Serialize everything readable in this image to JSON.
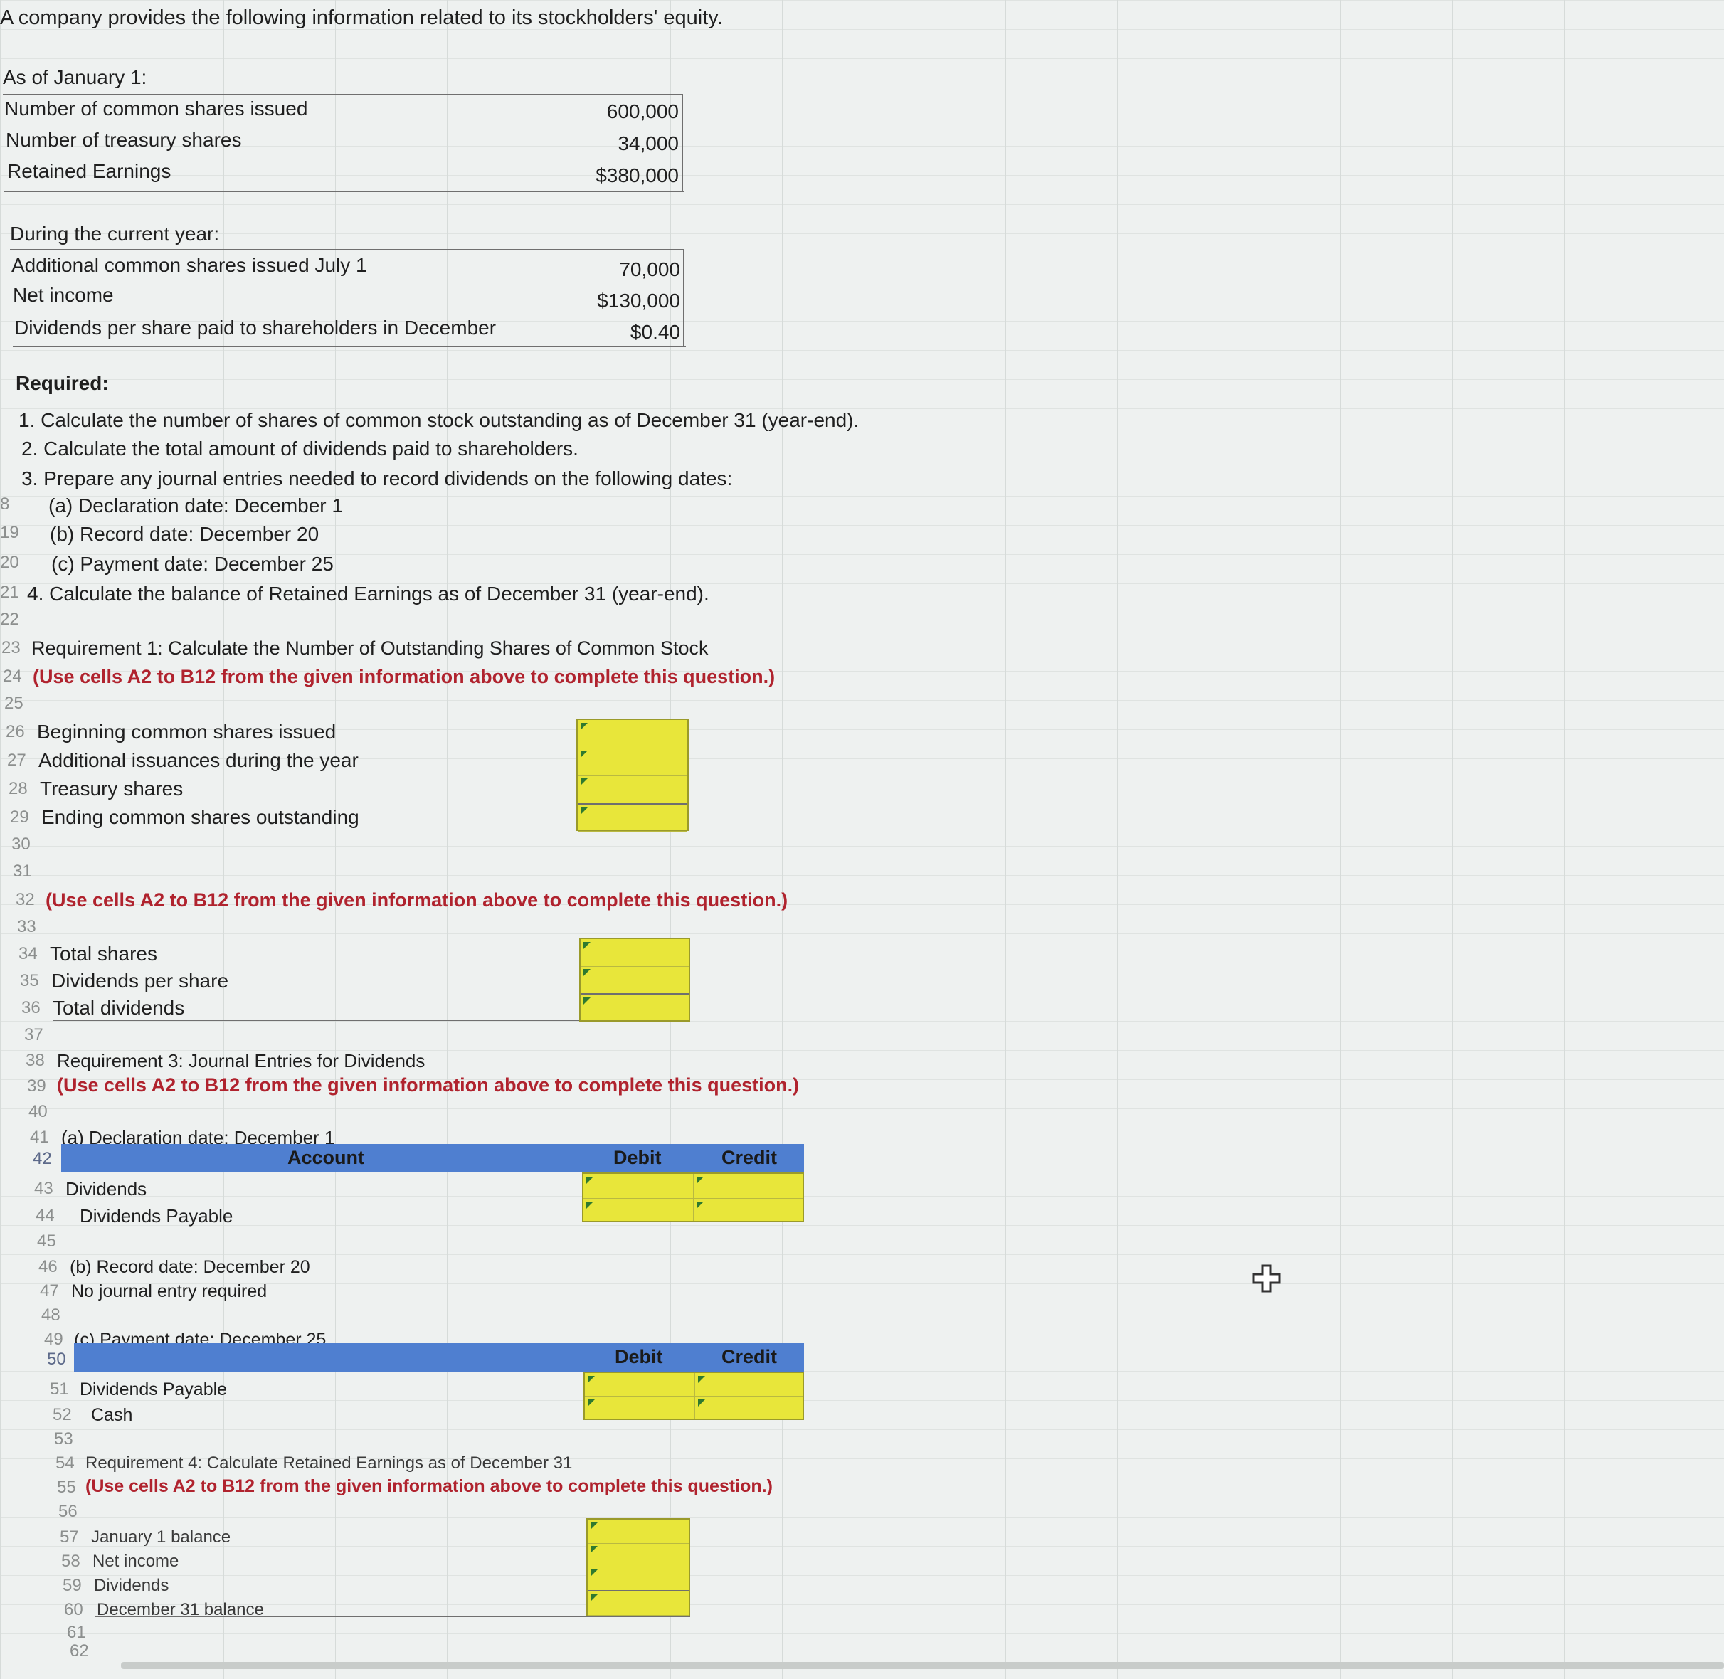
{
  "intro": "A company provides the following information related to its stockholders' equity.",
  "jan1": {
    "heading": "As of January 1:",
    "rows": [
      {
        "label": "Number of common shares issued",
        "value": "600,000"
      },
      {
        "label": "Number of treasury shares",
        "value": "34,000"
      },
      {
        "label": "Retained Earnings",
        "value": "$380,000"
      }
    ]
  },
  "year": {
    "heading": "During the current year:",
    "rows": [
      {
        "label": "Additional common shares issued July 1",
        "value": "70,000"
      },
      {
        "label": "Net income",
        "value": "$130,000"
      },
      {
        "label": "Dividends per share paid to shareholders in December",
        "value": "$0.40"
      }
    ]
  },
  "required": {
    "heading": "Required:",
    "items": [
      "1. Calculate the number of shares of common stock outstanding as of December 31 (year-end).",
      "2. Calculate the total amount of dividends paid to shareholders.",
      "3. Prepare any journal entries needed to record dividends on the following dates:",
      "(a) Declaration date: December 1",
      "(b) Record date: December 20",
      "(c) Payment date: December 25",
      "4. Calculate the balance of Retained Earnings as of December 31 (year-end)."
    ]
  },
  "row_numbers": [
    "8",
    "19",
    "20",
    "21",
    "22",
    "23",
    "24",
    "25",
    "26",
    "27",
    "28",
    "29",
    "30",
    "31",
    "32",
    "33",
    "34",
    "35",
    "36",
    "37",
    "38",
    "39",
    "40",
    "41",
    "42",
    "43",
    "44",
    "45",
    "46",
    "47",
    "48",
    "49",
    "50",
    "51",
    "52",
    "53",
    "54",
    "55",
    "56",
    "57",
    "58",
    "59",
    "60",
    "61",
    "62"
  ],
  "use_cells_note": "(Use cells A2 to B12 from the given information above to complete this question.)",
  "req1": {
    "title": "Requirement 1: Calculate the Number of Outstanding Shares of Common Stock",
    "rows": [
      "Beginning common shares issued",
      "Additional issuances during the year",
      "Treasury shares",
      "Ending common shares outstanding"
    ]
  },
  "req2": {
    "rows": [
      "Total shares",
      "Dividends per share",
      "Total dividends"
    ]
  },
  "req3": {
    "title": "Requirement 3: Journal Entries for Dividends",
    "declaration_label": "(a) Declaration date: December 1",
    "header_account": "Account",
    "header_debit": "Debit",
    "header_credit": "Credit",
    "declaration_rows": [
      "Dividends",
      "Dividends Payable"
    ],
    "record_label": "(b) Record date: December 20",
    "record_note": "No journal entry required",
    "payment_label": "(c) Payment date: December 25",
    "payment_rows": [
      "Dividends Payable",
      "Cash"
    ]
  },
  "req4": {
    "title": "Requirement 4: Calculate Retained Earnings as of December 31",
    "rows": [
      "January 1 balance",
      "Net income",
      "Dividends",
      "December 31 balance"
    ]
  }
}
